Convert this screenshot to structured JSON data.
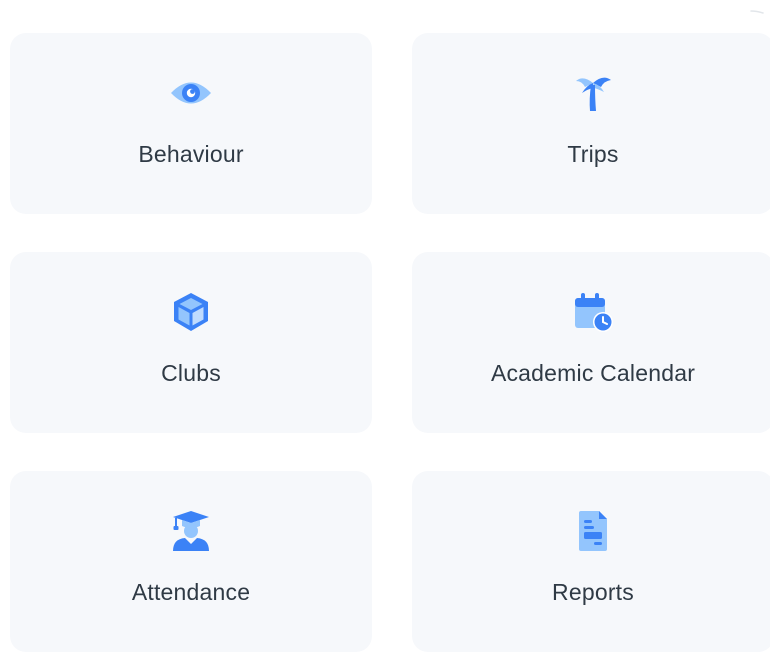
{
  "theme": {
    "tile_background": "#f6f8fb",
    "icon_primary": "#3b82f6",
    "icon_light": "#93c5fd",
    "label_color": "#2f3a45"
  },
  "tiles": [
    {
      "label": "Behaviour",
      "icon": "eye-icon"
    },
    {
      "label": "Trips",
      "icon": "palm-tree-icon"
    },
    {
      "label": "Clubs",
      "icon": "cube-icon"
    },
    {
      "label": "Academic Calendar",
      "icon": "calendar-clock-icon"
    },
    {
      "label": "Attendance",
      "icon": "graduate-icon"
    },
    {
      "label": "Reports",
      "icon": "document-icon"
    }
  ]
}
